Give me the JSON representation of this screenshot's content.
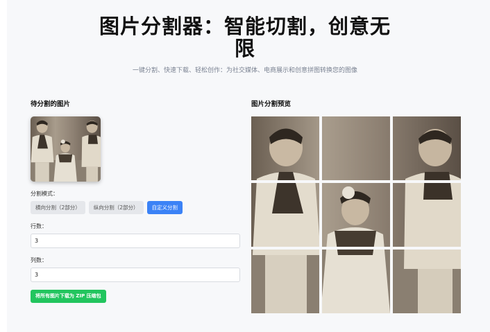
{
  "hero": {
    "title": "图片分割器：智能切割，创意无限",
    "subtitle": "一键分割、快速下载、轻松创作：为社交媒体、电商展示和创意拼图转换您的图像"
  },
  "left_panel": {
    "title": "待分割的图片",
    "mode_label": "分割模式：",
    "modes": [
      {
        "label": "横向分割（2部分）",
        "active": false
      },
      {
        "label": "纵向分割（2部分）",
        "active": false
      },
      {
        "label": "自定义分割",
        "active": true
      }
    ],
    "rows_label": "行数：",
    "rows_value": "3",
    "cols_label": "列数：",
    "cols_value": "3",
    "download_label": "将所有图片下载为 ZIP 压缩包"
  },
  "right_panel": {
    "title": "图片分割预览"
  },
  "colors": {
    "accent": "#3b82f6",
    "success": "#22c55e",
    "page_bg": "#f7f8fa",
    "sepia_dark": "#3a3128",
    "sepia_light": "#e4dccd"
  }
}
